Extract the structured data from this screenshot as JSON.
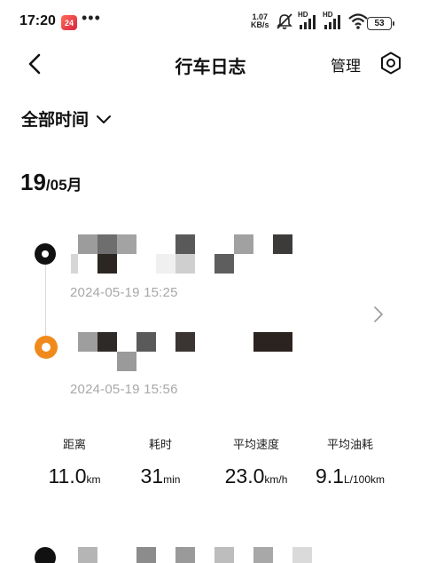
{
  "status_bar": {
    "time": "17:20",
    "app_badge": "24",
    "dots": "•••",
    "net_speed_value": "1.07",
    "net_speed_unit": "KB/s",
    "icons": [
      "mute-icon",
      "signal-icon",
      "signal-icon",
      "wifi-icon"
    ],
    "signal_labels": [
      "HD",
      "HD"
    ],
    "battery": "53"
  },
  "nav": {
    "title": "行车日志",
    "manage_label": "管理",
    "icons": [
      "back-arrow-icon",
      "settings-icon"
    ]
  },
  "filter": {
    "label": "全部时间"
  },
  "date_group": {
    "day": "19",
    "month": "/05月"
  },
  "trip": {
    "start_time": "2024-05-19 15:25",
    "end_time": "2024-05-19 15:56",
    "stats": [
      {
        "label": "距离",
        "value": "11.0",
        "unit": "km"
      },
      {
        "label": "耗时",
        "value": "31",
        "unit": "min"
      },
      {
        "label": "平均速度",
        "value": "23.0",
        "unit": "km/h"
      },
      {
        "label": "平均油耗",
        "value": "9.1",
        "unit": "L/100km"
      }
    ]
  }
}
